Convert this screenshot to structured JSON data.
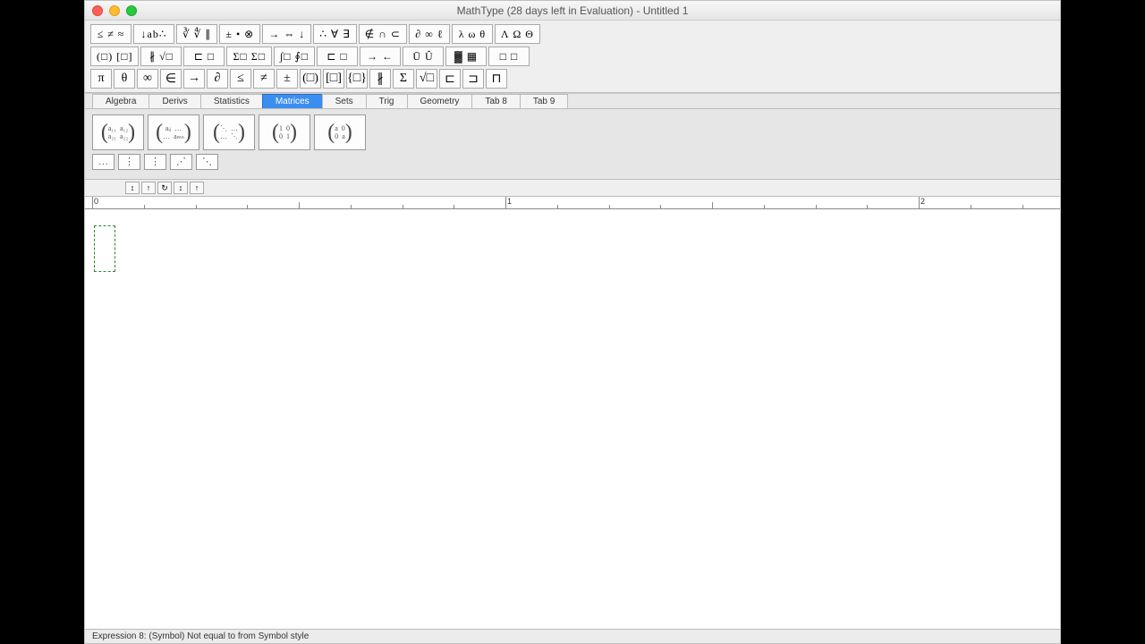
{
  "title": "MathType (28 days left in Evaluation) - Untitled 1",
  "palette_row1": [
    "≤ ≠ ≈",
    "↓ab∴",
    "∛ ∜ ∥",
    "± • ⊗",
    "→ ⇔ ↓",
    "∴ ∀ ∃",
    "∉ ∩ ⊂",
    "∂ ∞ ℓ",
    "λ ω θ",
    "Λ Ω Θ"
  ],
  "palette_row2": [
    "(□) [□]",
    "∦ √□",
    "⊏ □",
    "Σ□ Σ□",
    "∫□ ∮□",
    "⊏ □",
    "→ ←",
    "Ū Û",
    "▓ ▦",
    "□ □"
  ],
  "symbol_row": [
    "π",
    "θ",
    "∞",
    "∈",
    "→",
    "∂",
    "≤",
    "≠",
    "±",
    "(□)",
    "[□]",
    "{□}",
    "∦",
    "Σ",
    "√□",
    "⊏",
    "⊐",
    "⊓"
  ],
  "tabs": [
    "Algebra",
    "Derivs",
    "Statistics",
    "Matrices",
    "Sets",
    "Trig",
    "Geometry",
    "Tab 8",
    "Tab 9"
  ],
  "active_tab": 3,
  "matrix_templates_row1": [
    "( a₁₁ a₁₂ ; a₂₁ a₂₂ )",
    "( aᵢⱼ … ; … aₘₙ )",
    "( ⋱ … ; … ⋱ )",
    "( 1 0 ; 0 1 )",
    "( a 0 ; 0 a )"
  ],
  "matrix_templates_row2": [
    "…",
    "⋮",
    "⋮",
    "⋰",
    "⋱"
  ],
  "ruler_marks": [
    "0",
    "1",
    "2"
  ],
  "mini_tools": [
    "↕",
    "↑",
    "↻",
    "↕",
    "↑"
  ],
  "status": "Expression 8: (Symbol) Not equal to from Symbol style"
}
